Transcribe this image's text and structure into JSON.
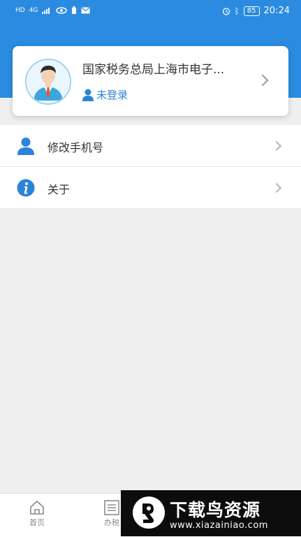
{
  "status_bar": {
    "left_indicators": [
      "HD",
      "4G",
      "eye",
      "battery-mini",
      "mail"
    ],
    "battery_level": "85",
    "time": "20:24"
  },
  "profile_card": {
    "title": "国家税务总局上海市电子...",
    "login_status": "未登录"
  },
  "menu": [
    {
      "label": "修改手机号",
      "icon": "user-icon"
    },
    {
      "label": "关于",
      "icon": "info-icon"
    }
  ],
  "bottom_nav": [
    {
      "label": "首页",
      "icon": "home-icon"
    },
    {
      "label": "办税",
      "icon": "list-icon"
    }
  ],
  "watermark": {
    "title": "下载鸟资源",
    "url": "www.xiazainiao.com"
  },
  "colors": {
    "header_blue": "#2b8be0",
    "accent_blue": "#2b84d8",
    "background": "#efefef"
  }
}
